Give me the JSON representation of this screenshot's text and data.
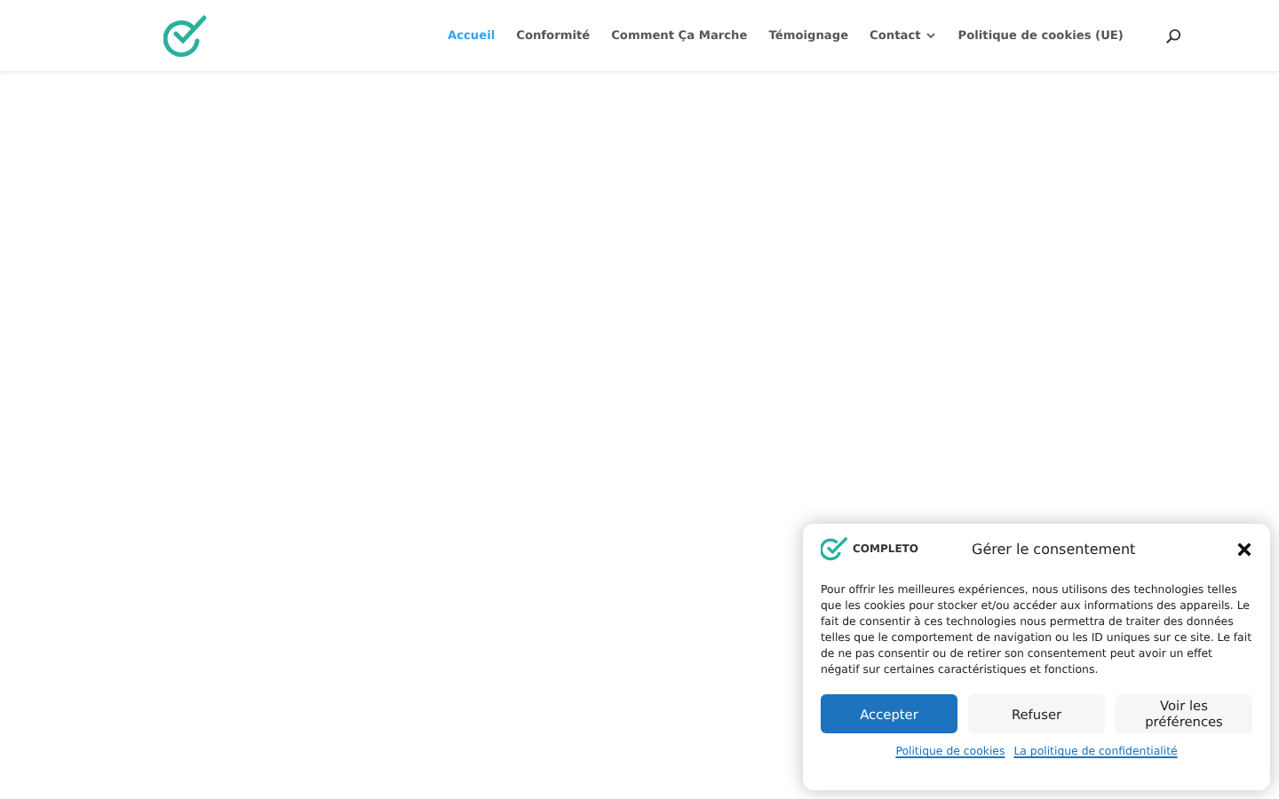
{
  "header": {
    "nav": [
      {
        "label": "Accueil",
        "selected": true,
        "has_submenu": false
      },
      {
        "label": "Conformité",
        "selected": false,
        "has_submenu": false
      },
      {
        "label": "Comment Ça Marche",
        "selected": false,
        "has_submenu": false
      },
      {
        "label": "Témoignage",
        "selected": false,
        "has_submenu": false
      },
      {
        "label": "Contact",
        "selected": false,
        "has_submenu": true
      },
      {
        "label": "Politique de cookies (UE)",
        "selected": false,
        "has_submenu": false
      }
    ]
  },
  "consent_dialog": {
    "brand": "COMPLETO",
    "title": "Gérer le consentement",
    "body": "Pour offrir les meilleures expériences, nous utilisons des technologies telles que les cookies pour stocker et/ou accéder aux informations des appareils. Le fait de consentir à ces technologies nous permettra de traiter des données telles que le comportement de navigation ou les ID uniques sur ce site. Le fait de ne pas consentir ou de retirer son consentement peut avoir un effet négatif sur certaines caractéristiques et fonctions.",
    "buttons": [
      {
        "label": "Accepter",
        "kind": "primary"
      },
      {
        "label": "Refuser",
        "kind": "secondary"
      },
      {
        "label": "Voir les préférences",
        "kind": "secondary"
      }
    ],
    "links": [
      "Politique de cookies",
      "La politique de confidentialité"
    ]
  }
}
